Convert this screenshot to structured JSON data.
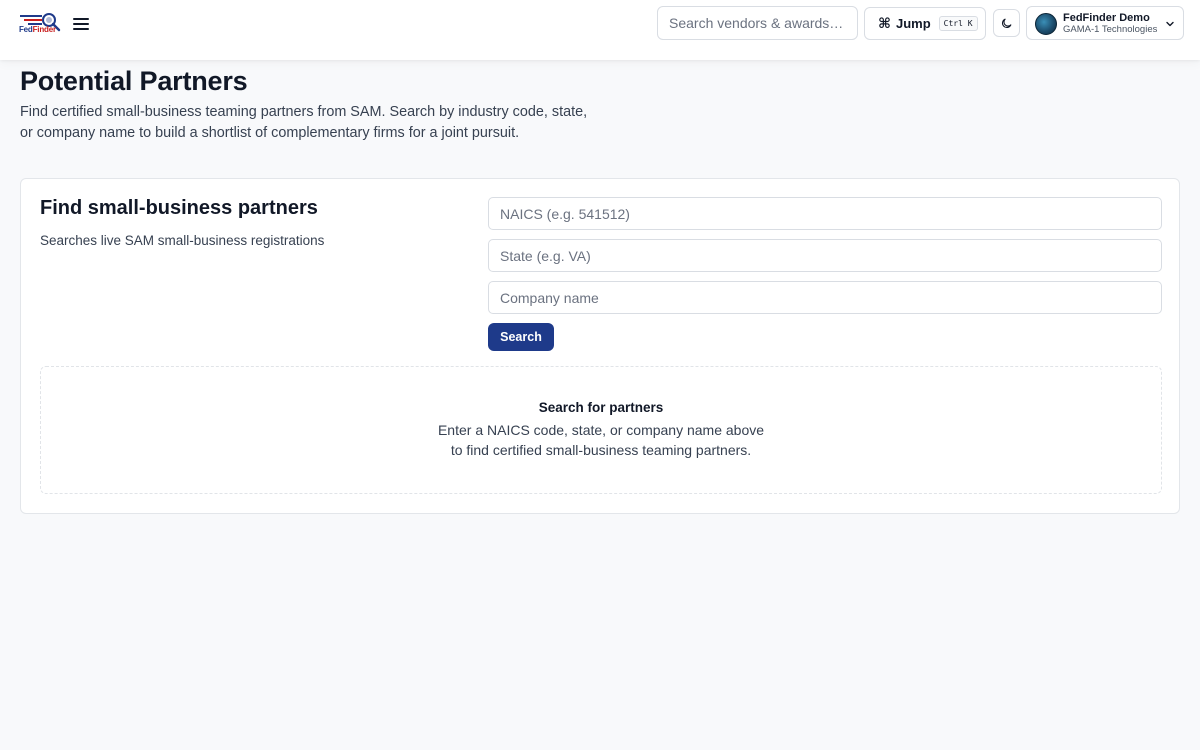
{
  "header": {
    "logo": {
      "part1": "Fed",
      "part2": "Finder"
    },
    "search_placeholder": "Search vendors & awards…",
    "jump": {
      "symbol": "⌘",
      "label": "Jump",
      "shortcut": "Ctrl K"
    },
    "user": {
      "name": "FedFinder Demo",
      "organization": "GAMA-1 Technologies"
    }
  },
  "page": {
    "title": "Potential Partners",
    "description": "Find certified small-business teaming partners from SAM. Search by industry code, state, or company name to build a shortlist of complementary firms for a joint pursuit."
  },
  "search_card": {
    "title": "Find small-business partners",
    "subtitle": "Searches live SAM small-business registrations",
    "naics_placeholder": "NAICS (e.g. 541512)",
    "state_placeholder": "State (e.g. VA)",
    "company_placeholder": "Company name",
    "search_label": "Search"
  },
  "empty_state": {
    "title": "Search for partners",
    "text": "Enter a NAICS code, state, or company name above to find certified small-business teaming partners."
  },
  "colors": {
    "brand_blue": "#1e3a8a",
    "brand_red": "#c81e1e",
    "background": "#f8f9fb"
  },
  "icons": [
    "magnifier-flag-logo-icon",
    "hamburger-menu-icon",
    "command-key-icon",
    "moon-icon",
    "avatar-globe-icon",
    "chevron-down-icon"
  ]
}
